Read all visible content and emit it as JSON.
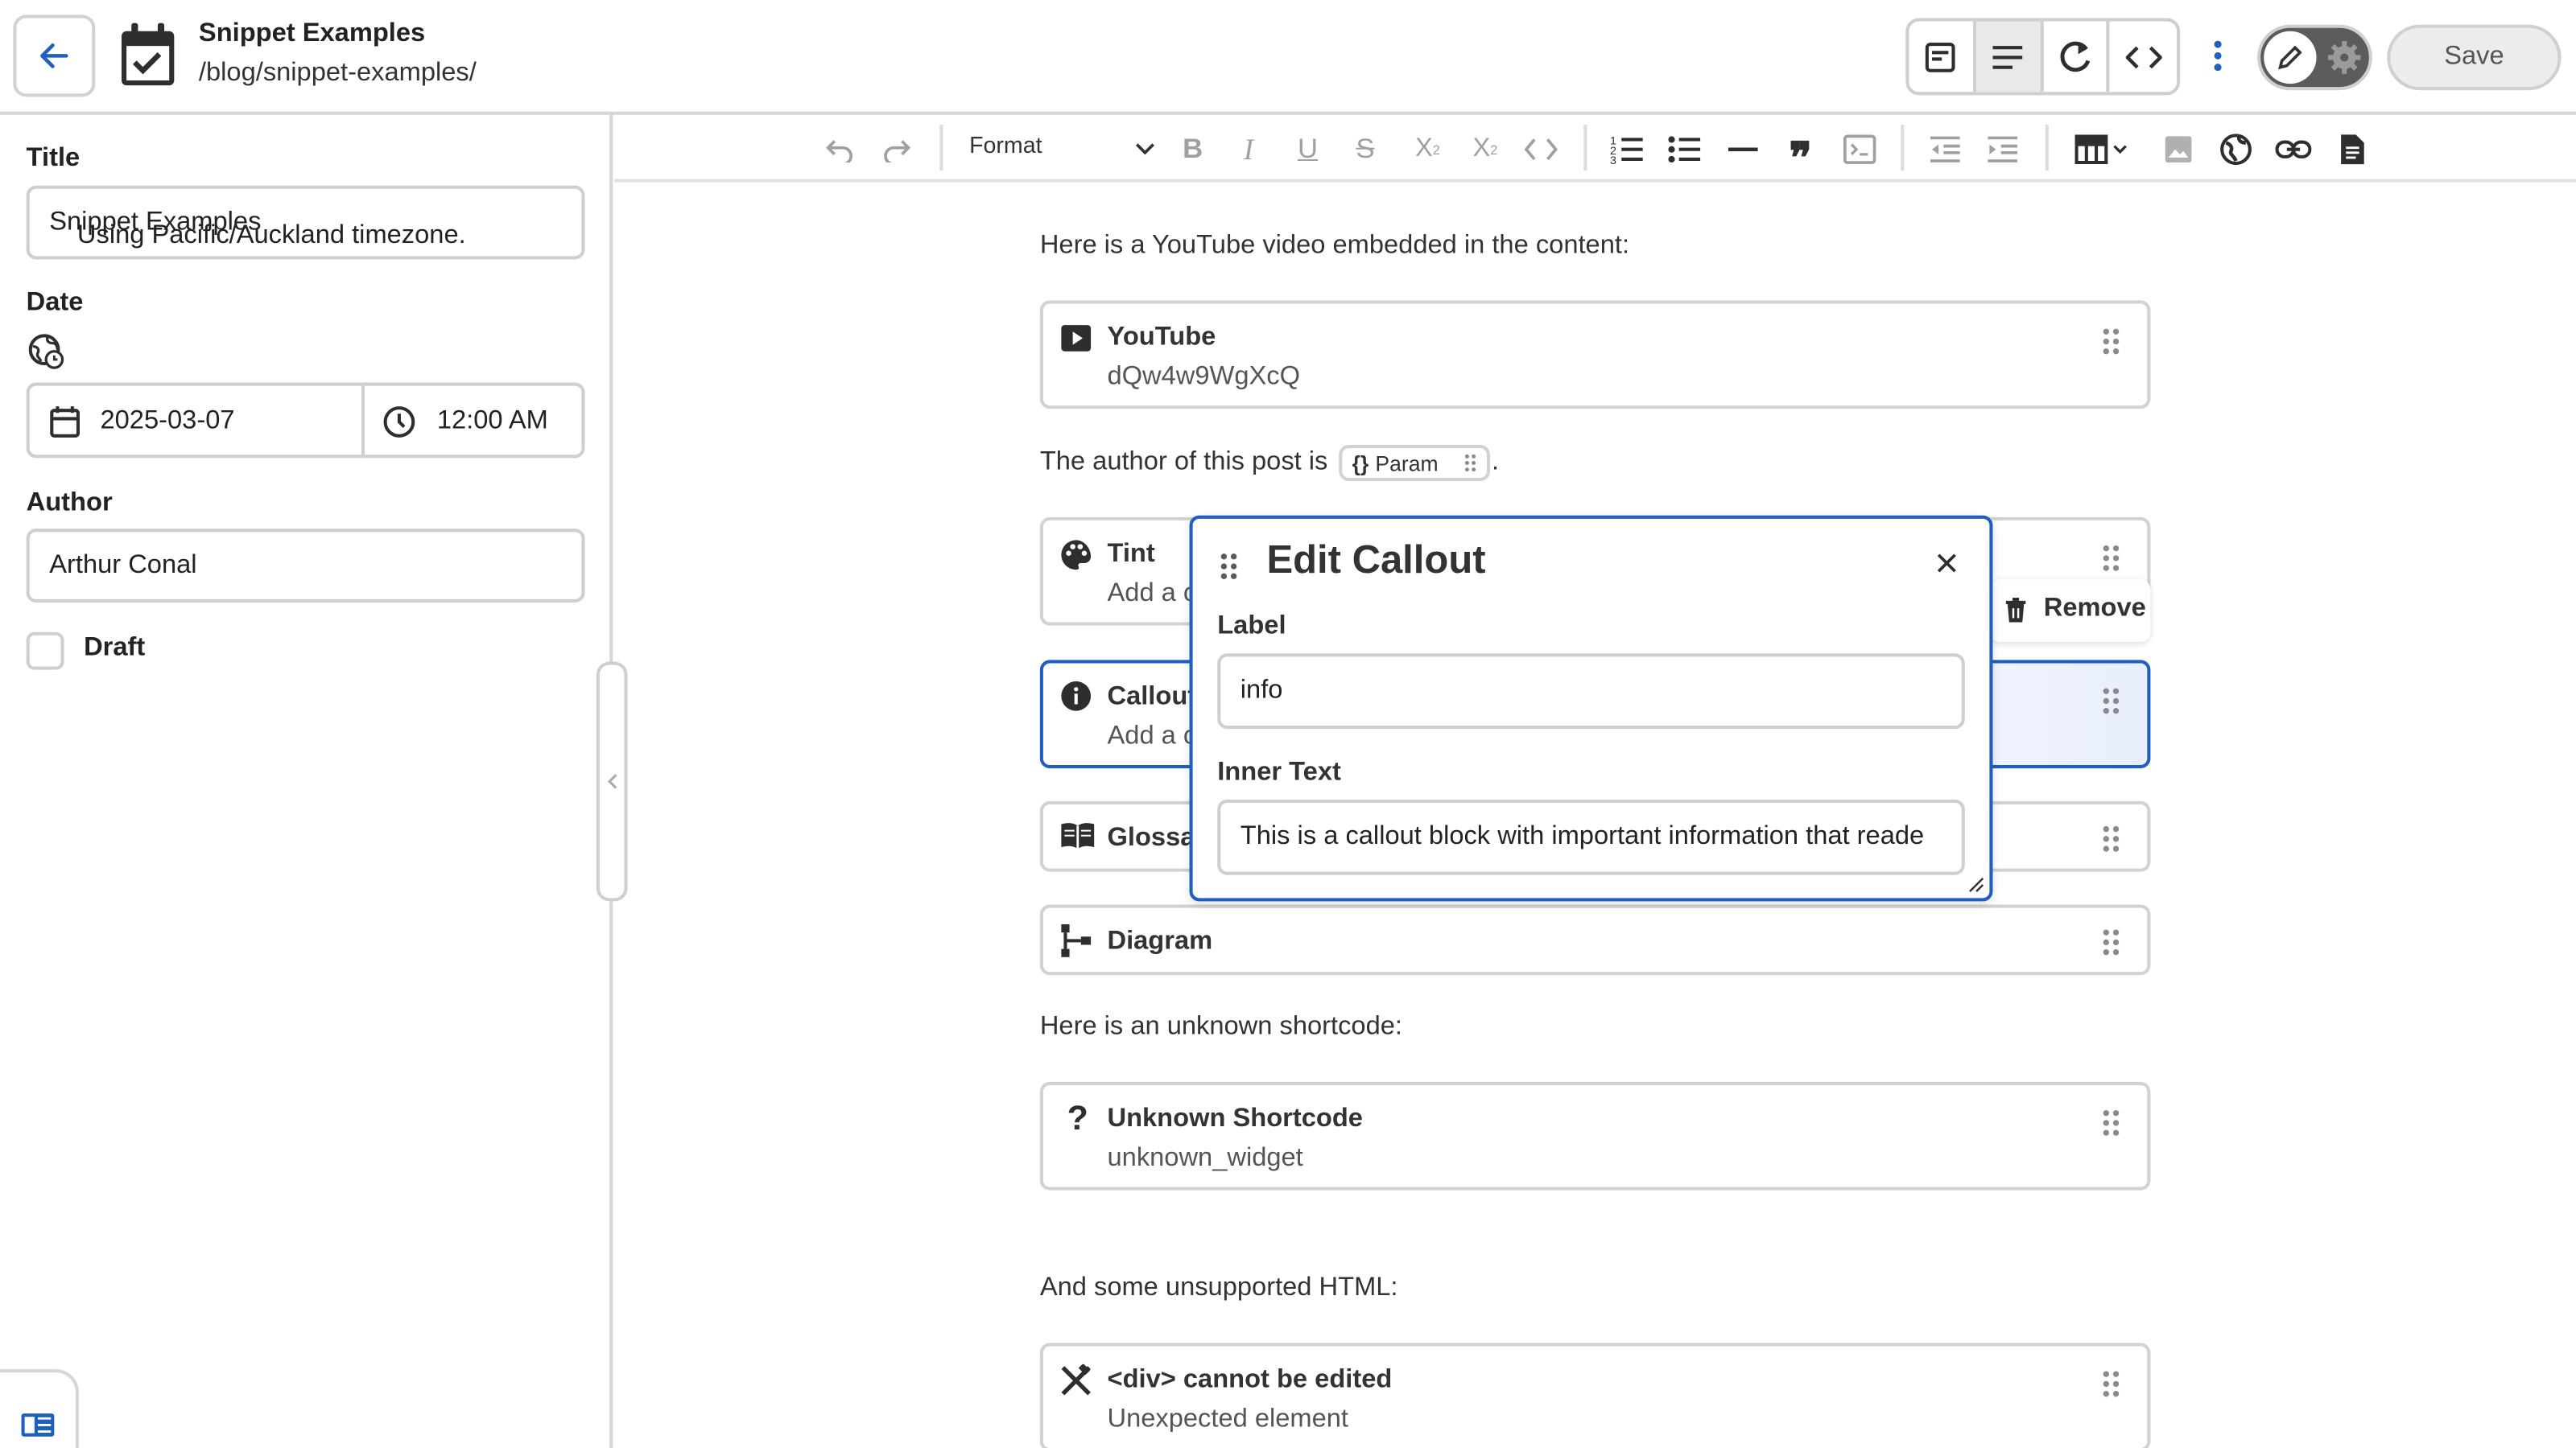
{
  "header": {
    "title": "Snippet Examples",
    "path": "/blog/snippet-examples/",
    "save_label": "Save"
  },
  "sidebar": {
    "title_label": "Title",
    "title_value": "Snippet Examples",
    "date_label": "Date",
    "timezone_text": "Using Pacific/Auckland timezone.",
    "date_value": "2025-03-07",
    "time_value": "12:00 AM",
    "author_label": "Author",
    "author_value": "Arthur Conal",
    "draft_label": "Draft"
  },
  "toolbar": {
    "format_label": "Format"
  },
  "content": {
    "intro_youtube": "Here is a YouTube video embedded in the content:",
    "author_prefix": "The author of this post is",
    "author_suffix": ".",
    "param_label": "Param",
    "unknown_intro": "Here is an unknown shortcode:",
    "html_intro": "And some unsupported HTML:",
    "blocks": [
      {
        "title": "YouTube",
        "subtitle": "dQw4w9WgXcQ",
        "icon": "youtube-icon"
      },
      {
        "title": "Tint",
        "subtitle": "Add a c",
        "icon": "palette-icon"
      },
      {
        "title": "Callout",
        "subtitle": "Add a c",
        "icon": "info-icon"
      },
      {
        "title": "Glossa",
        "subtitle": "",
        "icon": "book-icon"
      },
      {
        "title": "Diagram",
        "subtitle": "",
        "icon": "diagram-icon"
      },
      {
        "title": "Unknown Shortcode",
        "subtitle": "unknown_widget",
        "icon": "question-icon"
      },
      {
        "title": "<div> cannot be edited",
        "subtitle": "Unexpected element",
        "icon": "tools-icon"
      }
    ]
  },
  "popup": {
    "title": "Edit Callout",
    "label_label": "Label",
    "label_value": "info",
    "inner_label": "Inner Text",
    "inner_value": "This is a callout block with important information that reade",
    "remove_label": "Remove"
  },
  "colors": {
    "accent": "#1f5fbf",
    "border": "#d2d2d2",
    "toggle": "#5c5c5c"
  }
}
